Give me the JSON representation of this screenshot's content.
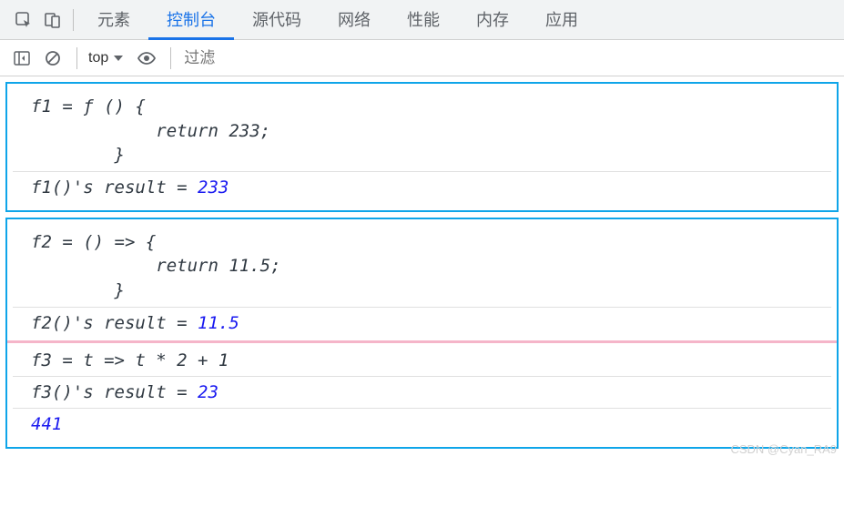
{
  "toolbar": {
    "tabs": [
      "元素",
      "控制台",
      "源代码",
      "网络",
      "性能",
      "内存",
      "应用"
    ],
    "active_tab_index": 1
  },
  "subtoolbar": {
    "context_label": "top",
    "filter_placeholder": "过滤"
  },
  "console": {
    "block1": {
      "code": "f1 = ƒ () {\n            return 233;\n        }",
      "result_label": "f1()'s result = ",
      "result_value": "233"
    },
    "block2": {
      "code": "f2 = () => {\n            return 11.5;\n        }",
      "result_label": "f2()'s result = ",
      "result_value": "11.5",
      "code2": "f3 = t => t * 2 + 1",
      "result2_label": "f3()'s result = ",
      "result2_value": "23",
      "final_value": "441"
    }
  },
  "watermark": "CSDN @Cyan_RA9"
}
